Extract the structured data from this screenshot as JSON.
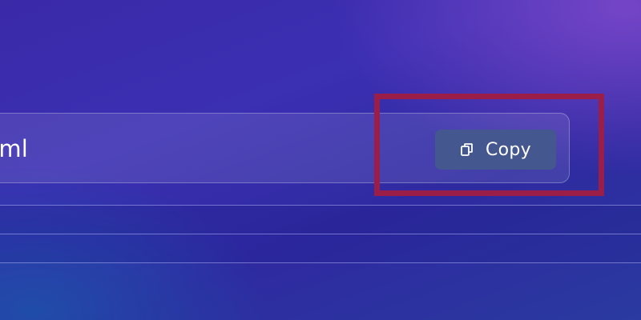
{
  "url_field": {
    "visible_text": "xml"
  },
  "copy_button": {
    "label": "Copy",
    "icon": "copy-icon"
  },
  "colors": {
    "button_bg": "#44578f",
    "highlight": "#9b1e48",
    "text": "#ffffff"
  }
}
